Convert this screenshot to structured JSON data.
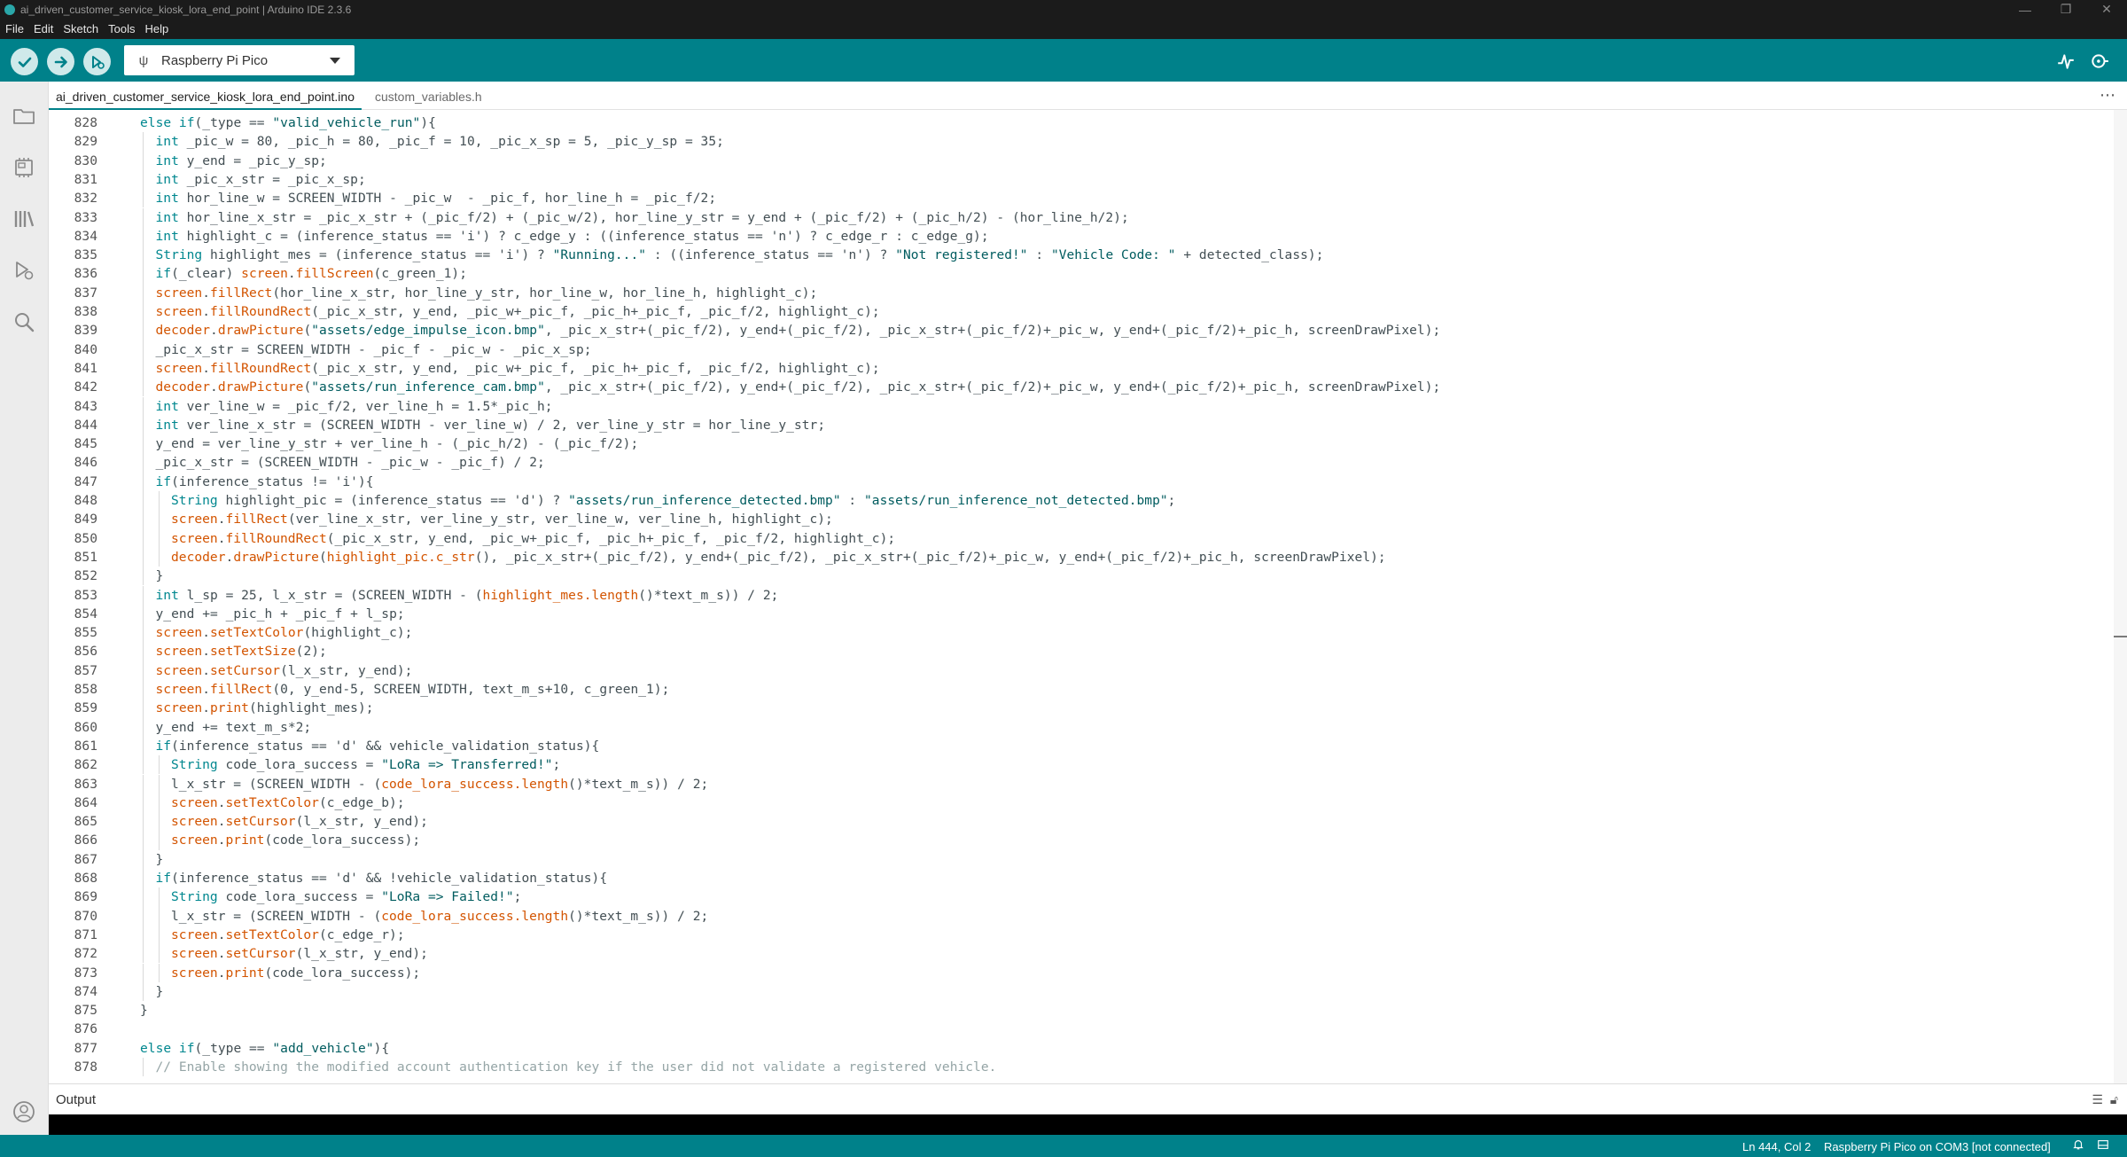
{
  "window": {
    "title": "ai_driven_customer_service_kiosk_lora_end_point | Arduino IDE 2.3.6",
    "controls": [
      "—",
      "❐",
      "✕"
    ]
  },
  "menu": [
    "File",
    "Edit",
    "Sketch",
    "Tools",
    "Help"
  ],
  "toolbar": {
    "verify_icon": "check-icon",
    "upload_icon": "arrow-right-icon",
    "debug_icon": "debug-icon",
    "board": "Raspberry Pi Pico",
    "serial_plotter_icon": "serial-plotter-icon",
    "serial_monitor_icon": "serial-monitor-icon"
  },
  "sidebar": [
    "folder-icon",
    "boards-manager-icon",
    "library-manager-icon",
    "debug-icon",
    "search-icon"
  ],
  "tabs": [
    {
      "label": "ai_driven_customer_service_kiosk_lora_end_point.ino",
      "active": true
    },
    {
      "label": "custom_variables.h",
      "active": false
    }
  ],
  "tab_more": "⋯",
  "code": [
    {
      "n": "828",
      "indent": 0,
      "t": [
        [
          "kw",
          "else if"
        ],
        [
          "plain",
          "(_type == "
        ],
        [
          "str",
          "\"valid_vehicle_run\""
        ],
        [
          "plain",
          "){"
        ]
      ]
    },
    {
      "n": "829",
      "indent": 1,
      "t": [
        [
          "ty",
          "int"
        ],
        [
          "plain",
          " _pic_w = 80, _pic_h = 80, _pic_f = 10, _pic_x_sp = 5, _pic_y_sp = 35;"
        ]
      ]
    },
    {
      "n": "830",
      "indent": 1,
      "t": [
        [
          "ty",
          "int"
        ],
        [
          "plain",
          " y_end = _pic_y_sp;"
        ]
      ]
    },
    {
      "n": "831",
      "indent": 1,
      "t": [
        [
          "ty",
          "int"
        ],
        [
          "plain",
          " _pic_x_str = _pic_x_sp;"
        ]
      ]
    },
    {
      "n": "832",
      "indent": 1,
      "t": [
        [
          "ty",
          "int"
        ],
        [
          "plain",
          " hor_line_w = SCREEN_WIDTH - _pic_w  - _pic_f, hor_line_h = _pic_f/2;"
        ]
      ]
    },
    {
      "n": "833",
      "indent": 1,
      "t": [
        [
          "ty",
          "int"
        ],
        [
          "plain",
          " hor_line_x_str = _pic_x_str + (_pic_f/2) + (_pic_w/2), hor_line_y_str = y_end + (_pic_f/2) + (_pic_h/2) - (hor_line_h/2);"
        ]
      ]
    },
    {
      "n": "834",
      "indent": 1,
      "t": [
        [
          "ty",
          "int"
        ],
        [
          "plain",
          " highlight_c = (inference_status == 'i') ? c_edge_y : ((inference_status == 'n') ? c_edge_r : c_edge_g);"
        ]
      ]
    },
    {
      "n": "835",
      "indent": 1,
      "t": [
        [
          "ty",
          "String"
        ],
        [
          "plain",
          " highlight_mes = (inference_status == 'i') ? "
        ],
        [
          "str",
          "\"Running...\""
        ],
        [
          "plain",
          " : ((inference_status == 'n') ? "
        ],
        [
          "str",
          "\"Not registered!\""
        ],
        [
          "plain",
          " : "
        ],
        [
          "str",
          "\"Vehicle Code: \""
        ],
        [
          "plain",
          " + detected_class);"
        ]
      ]
    },
    {
      "n": "836",
      "indent": 1,
      "t": [
        [
          "kw",
          "if"
        ],
        [
          "plain",
          "(_clear) "
        ],
        [
          "obj",
          "screen"
        ],
        [
          "plain",
          "."
        ],
        [
          "fn",
          "fillScreen"
        ],
        [
          "plain",
          "(c_green_1);"
        ]
      ]
    },
    {
      "n": "837",
      "indent": 1,
      "t": [
        [
          "obj",
          "screen"
        ],
        [
          "plain",
          "."
        ],
        [
          "fn",
          "fillRect"
        ],
        [
          "plain",
          "(hor_line_x_str, hor_line_y_str, hor_line_w, hor_line_h, highlight_c);"
        ]
      ]
    },
    {
      "n": "838",
      "indent": 1,
      "t": [
        [
          "obj",
          "screen"
        ],
        [
          "plain",
          "."
        ],
        [
          "fn",
          "fillRoundRect"
        ],
        [
          "plain",
          "(_pic_x_str, y_end, _pic_w+_pic_f, _pic_h+_pic_f, _pic_f/2, highlight_c);"
        ]
      ]
    },
    {
      "n": "839",
      "indent": 1,
      "t": [
        [
          "obj",
          "decoder"
        ],
        [
          "plain",
          "."
        ],
        [
          "fn",
          "drawPicture"
        ],
        [
          "plain",
          "("
        ],
        [
          "str",
          "\"assets/edge_impulse_icon.bmp\""
        ],
        [
          "plain",
          ", _pic_x_str+(_pic_f/2), y_end+(_pic_f/2), _pic_x_str+(_pic_f/2)+_pic_w, y_end+(_pic_f/2)+_pic_h, screenDrawPixel);"
        ]
      ]
    },
    {
      "n": "840",
      "indent": 1,
      "t": [
        [
          "plain",
          "_pic_x_str = SCREEN_WIDTH - _pic_f - _pic_w - _pic_x_sp;"
        ]
      ]
    },
    {
      "n": "841",
      "indent": 1,
      "t": [
        [
          "obj",
          "screen"
        ],
        [
          "plain",
          "."
        ],
        [
          "fn",
          "fillRoundRect"
        ],
        [
          "plain",
          "(_pic_x_str, y_end, _pic_w+_pic_f, _pic_h+_pic_f, _pic_f/2, highlight_c);"
        ]
      ]
    },
    {
      "n": "842",
      "indent": 1,
      "t": [
        [
          "obj",
          "decoder"
        ],
        [
          "plain",
          "."
        ],
        [
          "fn",
          "drawPicture"
        ],
        [
          "plain",
          "("
        ],
        [
          "str",
          "\"assets/run_inference_cam.bmp\""
        ],
        [
          "plain",
          ", _pic_x_str+(_pic_f/2), y_end+(_pic_f/2), _pic_x_str+(_pic_f/2)+_pic_w, y_end+(_pic_f/2)+_pic_h, screenDrawPixel);"
        ]
      ]
    },
    {
      "n": "843",
      "indent": 1,
      "t": [
        [
          "ty",
          "int"
        ],
        [
          "plain",
          " ver_line_w = _pic_f/2, ver_line_h = 1.5*_pic_h;"
        ]
      ]
    },
    {
      "n": "844",
      "indent": 1,
      "t": [
        [
          "ty",
          "int"
        ],
        [
          "plain",
          " ver_line_x_str = (SCREEN_WIDTH - ver_line_w) / 2, ver_line_y_str = hor_line_y_str;"
        ]
      ]
    },
    {
      "n": "845",
      "indent": 1,
      "t": [
        [
          "plain",
          "y_end = ver_line_y_str + ver_line_h - (_pic_h/2) - (_pic_f/2);"
        ]
      ]
    },
    {
      "n": "846",
      "indent": 1,
      "t": [
        [
          "plain",
          "_pic_x_str = (SCREEN_WIDTH - _pic_w - _pic_f) / 2;"
        ]
      ]
    },
    {
      "n": "847",
      "indent": 1,
      "t": [
        [
          "kw",
          "if"
        ],
        [
          "plain",
          "(inference_status != 'i'){"
        ]
      ]
    },
    {
      "n": "848",
      "indent": 2,
      "t": [
        [
          "ty",
          "String"
        ],
        [
          "plain",
          " highlight_pic = (inference_status == 'd') ? "
        ],
        [
          "str",
          "\"assets/run_inference_detected.bmp\""
        ],
        [
          "plain",
          " : "
        ],
        [
          "str",
          "\"assets/run_inference_not_detected.bmp\""
        ],
        [
          "plain",
          ";"
        ]
      ]
    },
    {
      "n": "849",
      "indent": 2,
      "t": [
        [
          "obj",
          "screen"
        ],
        [
          "plain",
          "."
        ],
        [
          "fn",
          "fillRect"
        ],
        [
          "plain",
          "(ver_line_x_str, ver_line_y_str, ver_line_w, ver_line_h, highlight_c);"
        ]
      ]
    },
    {
      "n": "850",
      "indent": 2,
      "t": [
        [
          "obj",
          "screen"
        ],
        [
          "plain",
          "."
        ],
        [
          "fn",
          "fillRoundRect"
        ],
        [
          "plain",
          "(_pic_x_str, y_end, _pic_w+_pic_f, _pic_h+_pic_f, _pic_f/2, highlight_c);"
        ]
      ]
    },
    {
      "n": "851",
      "indent": 2,
      "t": [
        [
          "obj",
          "decoder"
        ],
        [
          "plain",
          "."
        ],
        [
          "fn",
          "drawPicture"
        ],
        [
          "plain",
          "("
        ],
        [
          "fn",
          "highlight_pic.c_str"
        ],
        [
          "plain",
          "(), _pic_x_str+(_pic_f/2), y_end+(_pic_f/2), _pic_x_str+(_pic_f/2)+_pic_w, y_end+(_pic_f/2)+_pic_h, screenDrawPixel);"
        ]
      ]
    },
    {
      "n": "852",
      "indent": 1,
      "t": [
        [
          "plain",
          "}"
        ]
      ]
    },
    {
      "n": "853",
      "indent": 1,
      "t": [
        [
          "ty",
          "int"
        ],
        [
          "plain",
          " l_sp = 25, l_x_str = (SCREEN_WIDTH - ("
        ],
        [
          "fn",
          "highlight_mes.length"
        ],
        [
          "plain",
          "()*text_m_s)) / 2;"
        ]
      ]
    },
    {
      "n": "854",
      "indent": 1,
      "t": [
        [
          "plain",
          "y_end += _pic_h + _pic_f + l_sp;"
        ]
      ]
    },
    {
      "n": "855",
      "indent": 1,
      "t": [
        [
          "obj",
          "screen"
        ],
        [
          "plain",
          "."
        ],
        [
          "fn",
          "setTextColor"
        ],
        [
          "plain",
          "(highlight_c);"
        ]
      ]
    },
    {
      "n": "856",
      "indent": 1,
      "t": [
        [
          "obj",
          "screen"
        ],
        [
          "plain",
          "."
        ],
        [
          "fn",
          "setTextSize"
        ],
        [
          "plain",
          "(2);"
        ]
      ]
    },
    {
      "n": "857",
      "indent": 1,
      "t": [
        [
          "obj",
          "screen"
        ],
        [
          "plain",
          "."
        ],
        [
          "fn",
          "setCursor"
        ],
        [
          "plain",
          "(l_x_str, y_end);"
        ]
      ]
    },
    {
      "n": "858",
      "indent": 1,
      "t": [
        [
          "obj",
          "screen"
        ],
        [
          "plain",
          "."
        ],
        [
          "fn",
          "fillRect"
        ],
        [
          "plain",
          "(0, y_end-5, SCREEN_WIDTH, text_m_s+10, c_green_1);"
        ]
      ]
    },
    {
      "n": "859",
      "indent": 1,
      "t": [
        [
          "obj",
          "screen"
        ],
        [
          "plain",
          "."
        ],
        [
          "fn",
          "print"
        ],
        [
          "plain",
          "(highlight_mes);"
        ]
      ]
    },
    {
      "n": "860",
      "indent": 1,
      "t": [
        [
          "plain",
          "y_end += text_m_s*2;"
        ]
      ]
    },
    {
      "n": "861",
      "indent": 1,
      "t": [
        [
          "kw",
          "if"
        ],
        [
          "plain",
          "(inference_status == 'd' && vehicle_validation_status){"
        ]
      ]
    },
    {
      "n": "862",
      "indent": 2,
      "t": [
        [
          "ty",
          "String"
        ],
        [
          "plain",
          " code_lora_success = "
        ],
        [
          "str",
          "\"LoRa => Transferred!\""
        ],
        [
          "plain",
          ";"
        ]
      ]
    },
    {
      "n": "863",
      "indent": 2,
      "t": [
        [
          "plain",
          "l_x_str = (SCREEN_WIDTH - ("
        ],
        [
          "fn",
          "code_lora_success.length"
        ],
        [
          "plain",
          "()*text_m_s)) / 2;"
        ]
      ]
    },
    {
      "n": "864",
      "indent": 2,
      "t": [
        [
          "obj",
          "screen"
        ],
        [
          "plain",
          "."
        ],
        [
          "fn",
          "setTextColor"
        ],
        [
          "plain",
          "(c_edge_b);"
        ]
      ]
    },
    {
      "n": "865",
      "indent": 2,
      "t": [
        [
          "obj",
          "screen"
        ],
        [
          "plain",
          "."
        ],
        [
          "fn",
          "setCursor"
        ],
        [
          "plain",
          "(l_x_str, y_end);"
        ]
      ]
    },
    {
      "n": "866",
      "indent": 2,
      "t": [
        [
          "obj",
          "screen"
        ],
        [
          "plain",
          "."
        ],
        [
          "fn",
          "print"
        ],
        [
          "plain",
          "(code_lora_success);"
        ]
      ]
    },
    {
      "n": "867",
      "indent": 1,
      "t": [
        [
          "plain",
          "}"
        ]
      ]
    },
    {
      "n": "868",
      "indent": 1,
      "t": [
        [
          "kw",
          "if"
        ],
        [
          "plain",
          "(inference_status == 'd' && !vehicle_validation_status){"
        ]
      ]
    },
    {
      "n": "869",
      "indent": 2,
      "t": [
        [
          "ty",
          "String"
        ],
        [
          "plain",
          " code_lora_success = "
        ],
        [
          "str",
          "\"LoRa => Failed!\""
        ],
        [
          "plain",
          ";"
        ]
      ]
    },
    {
      "n": "870",
      "indent": 2,
      "t": [
        [
          "plain",
          "l_x_str = (SCREEN_WIDTH - ("
        ],
        [
          "fn",
          "code_lora_success.length"
        ],
        [
          "plain",
          "()*text_m_s)) / 2;"
        ]
      ]
    },
    {
      "n": "871",
      "indent": 2,
      "t": [
        [
          "obj",
          "screen"
        ],
        [
          "plain",
          "."
        ],
        [
          "fn",
          "setTextColor"
        ],
        [
          "plain",
          "(c_edge_r);"
        ]
      ]
    },
    {
      "n": "872",
      "indent": 2,
      "t": [
        [
          "obj",
          "screen"
        ],
        [
          "plain",
          "."
        ],
        [
          "fn",
          "setCursor"
        ],
        [
          "plain",
          "(l_x_str, y_end);"
        ]
      ]
    },
    {
      "n": "873",
      "indent": 2,
      "t": [
        [
          "obj",
          "screen"
        ],
        [
          "plain",
          "."
        ],
        [
          "fn",
          "print"
        ],
        [
          "plain",
          "(code_lora_success);"
        ]
      ]
    },
    {
      "n": "874",
      "indent": 1,
      "t": [
        [
          "plain",
          "}"
        ]
      ]
    },
    {
      "n": "875",
      "indent": 0,
      "t": [
        [
          "plain",
          "}"
        ]
      ]
    },
    {
      "n": "876",
      "indent": 0,
      "t": []
    },
    {
      "n": "877",
      "indent": 0,
      "t": [
        [
          "kw",
          "else if"
        ],
        [
          "plain",
          "(_type == "
        ],
        [
          "str",
          "\"add_vehicle\""
        ],
        [
          "plain",
          "){"
        ]
      ]
    },
    {
      "n": "878",
      "indent": 1,
      "t": [
        [
          "cm",
          "// Enable showing the modified account authentication key if the user did not validate a registered vehicle."
        ]
      ]
    }
  ],
  "output": {
    "label": "Output",
    "icons": [
      "clear-output-icon",
      "lock-scroll-icon"
    ]
  },
  "statusbar": {
    "position": "Ln 444, Col 2",
    "board": "Raspberry Pi Pico on COM3 [not connected]",
    "icons": [
      "notification-bell-icon",
      "toggle-panel-icon"
    ]
  },
  "colors": {
    "accent": "#00818a",
    "titlebar": "#1b1b1b",
    "keyword": "#00878f",
    "function": "#d35400",
    "string": "#005c5f",
    "comment": "#95a5a6"
  }
}
